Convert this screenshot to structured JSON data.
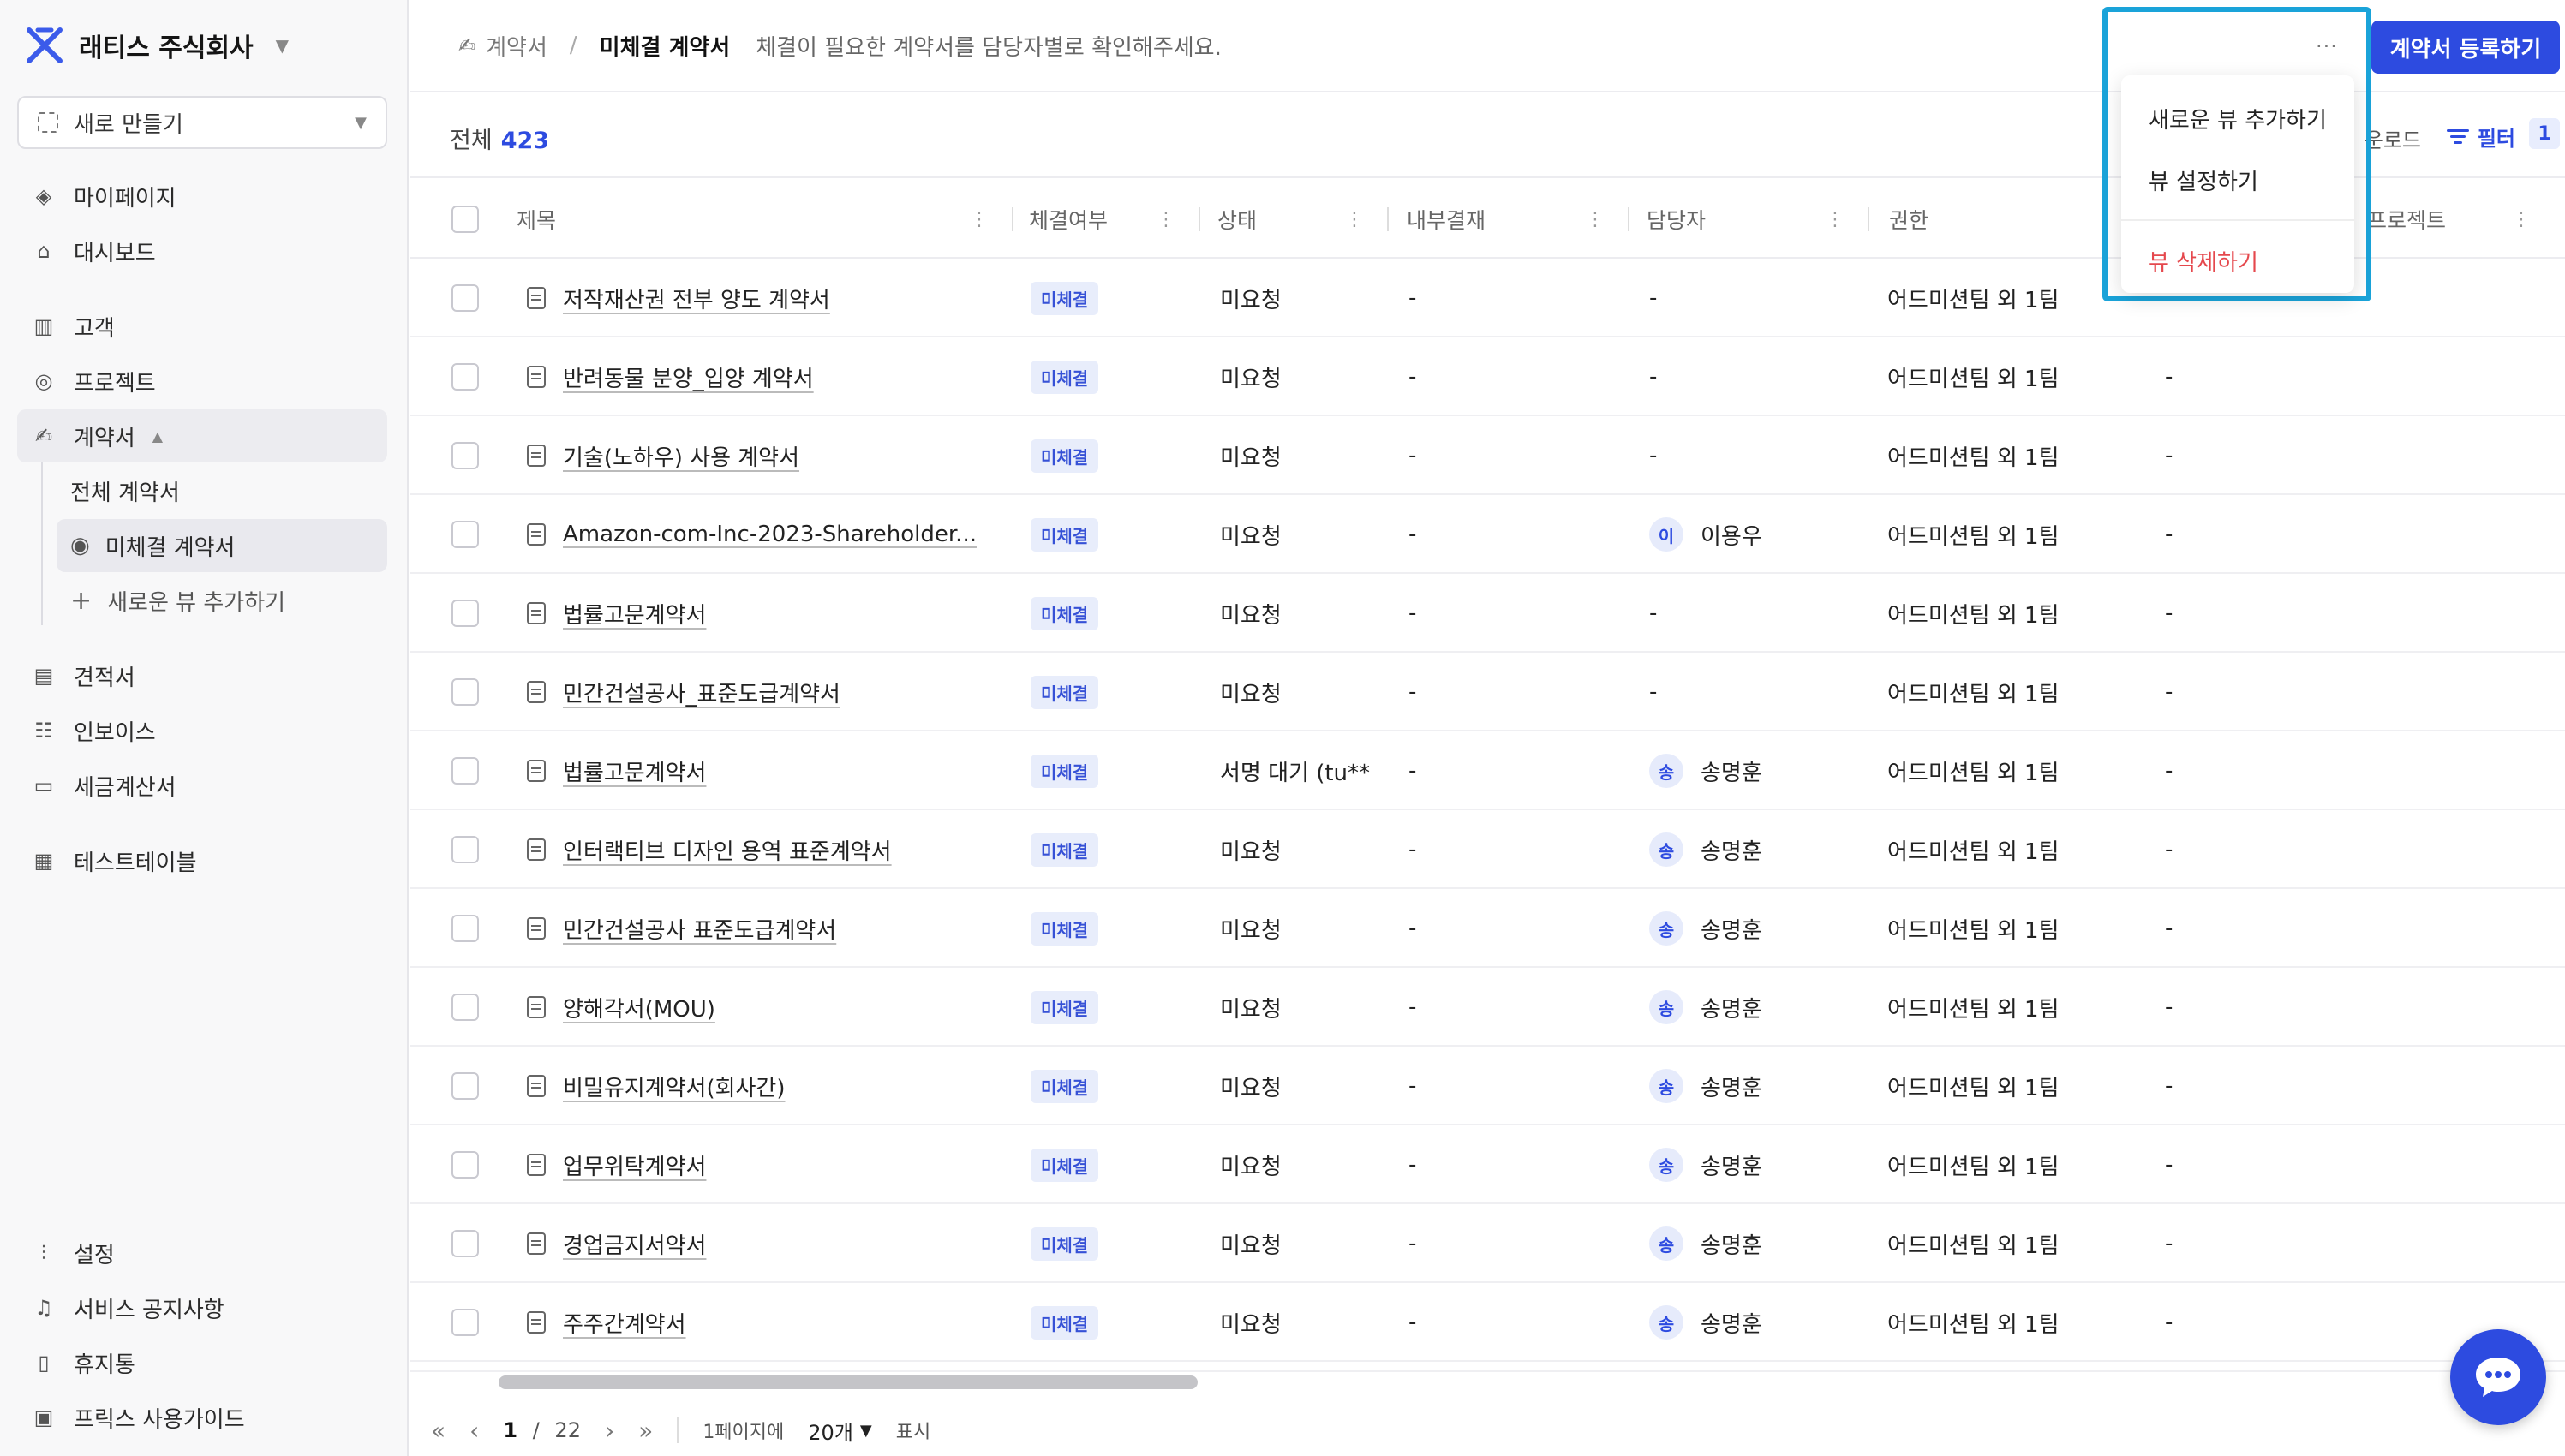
{
  "sidebar": {
    "company": "래티스 주식회사",
    "new_button": "새로 만들기",
    "items": [
      {
        "label": "마이페이지",
        "icon": "diamond-icon"
      },
      {
        "label": "대시보드",
        "icon": "home-icon"
      },
      {
        "label": "고객",
        "icon": "building-icon"
      },
      {
        "label": "프로젝트",
        "icon": "target-icon"
      },
      {
        "label": "계약서",
        "icon": "signature-icon"
      },
      {
        "label": "견적서",
        "icon": "document-icon"
      },
      {
        "label": "인보이스",
        "icon": "invoice-icon"
      },
      {
        "label": "세금계산서",
        "icon": "receipt-icon"
      },
      {
        "label": "테스트테이블",
        "icon": "table-icon"
      }
    ],
    "sub_items": [
      {
        "label": "전체 계약서"
      },
      {
        "label": "미체결 계약서"
      },
      {
        "label": "새로운 뷰 추가하기"
      }
    ],
    "bottom_items": [
      {
        "label": "설정",
        "icon": "sliders-icon"
      },
      {
        "label": "서비스 공지사항",
        "icon": "bell-icon"
      },
      {
        "label": "휴지통",
        "icon": "trash-icon"
      },
      {
        "label": "프릭스 사용가이드",
        "icon": "book-icon"
      }
    ]
  },
  "header": {
    "breadcrumb_parent": "계약서",
    "breadcrumb_current": "미체결 계약서",
    "description": "체결이 필요한 계약서를 담당자별로 확인해주세요.",
    "primary_button": "계약서 등록하기",
    "more_label": "···"
  },
  "toolbar": {
    "total_label": "전체",
    "total_count": "423",
    "download_label": "운로드",
    "filter_label": "필터",
    "filter_count": "1"
  },
  "table": {
    "columns": [
      "제목",
      "체결여부",
      "상태",
      "내부결재",
      "담당자",
      "권한",
      "프로젝트"
    ],
    "rows": [
      {
        "title": "저작재산권 전부 양도 계약서",
        "signed": "미체결",
        "status": "미요청",
        "approval": "-",
        "avatar": "",
        "manager": "-",
        "permission": "어드미션팀 외 1팀",
        "project": "-"
      },
      {
        "title": "반려동물 분양_입양 계약서",
        "signed": "미체결",
        "status": "미요청",
        "approval": "-",
        "avatar": "",
        "manager": "-",
        "permission": "어드미션팀 외 1팀",
        "project": "-"
      },
      {
        "title": "기술(노하우) 사용 계약서",
        "signed": "미체결",
        "status": "미요청",
        "approval": "-",
        "avatar": "",
        "manager": "-",
        "permission": "어드미션팀 외 1팀",
        "project": "-"
      },
      {
        "title": "Amazon-com-Inc-2023-Shareholder...",
        "signed": "미체결",
        "status": "미요청",
        "approval": "-",
        "avatar": "이",
        "manager": "이용우",
        "permission": "어드미션팀 외 1팀",
        "project": "-"
      },
      {
        "title": "법률고문계약서",
        "signed": "미체결",
        "status": "미요청",
        "approval": "-",
        "avatar": "",
        "manager": "-",
        "permission": "어드미션팀 외 1팀",
        "project": "-"
      },
      {
        "title": "민간건설공사_표준도급계약서",
        "signed": "미체결",
        "status": "미요청",
        "approval": "-",
        "avatar": "",
        "manager": "-",
        "permission": "어드미션팀 외 1팀",
        "project": "-"
      },
      {
        "title": "법률고문계약서",
        "signed": "미체결",
        "status": "서명 대기 (tu**",
        "approval": "-",
        "avatar": "송",
        "manager": "송명훈",
        "permission": "어드미션팀 외 1팀",
        "project": "-"
      },
      {
        "title": "인터랙티브 디자인 용역 표준계약서",
        "signed": "미체결",
        "status": "미요청",
        "approval": "-",
        "avatar": "송",
        "manager": "송명훈",
        "permission": "어드미션팀 외 1팀",
        "project": "-"
      },
      {
        "title": "민간건설공사 표준도급계약서",
        "signed": "미체결",
        "status": "미요청",
        "approval": "-",
        "avatar": "송",
        "manager": "송명훈",
        "permission": "어드미션팀 외 1팀",
        "project": "-"
      },
      {
        "title": "양해각서(MOU)",
        "signed": "미체결",
        "status": "미요청",
        "approval": "-",
        "avatar": "송",
        "manager": "송명훈",
        "permission": "어드미션팀 외 1팀",
        "project": "-"
      },
      {
        "title": "비밀유지계약서(회사간)",
        "signed": "미체결",
        "status": "미요청",
        "approval": "-",
        "avatar": "송",
        "manager": "송명훈",
        "permission": "어드미션팀 외 1팀",
        "project": "-"
      },
      {
        "title": "업무위탁계약서",
        "signed": "미체결",
        "status": "미요청",
        "approval": "-",
        "avatar": "송",
        "manager": "송명훈",
        "permission": "어드미션팀 외 1팀",
        "project": "-"
      },
      {
        "title": "경업금지서약서",
        "signed": "미체결",
        "status": "미요청",
        "approval": "-",
        "avatar": "송",
        "manager": "송명훈",
        "permission": "어드미션팀 외 1팀",
        "project": "-"
      },
      {
        "title": "주주간계약서",
        "signed": "미체결",
        "status": "미요청",
        "approval": "-",
        "avatar": "송",
        "manager": "송명훈",
        "permission": "어드미션팀 외 1팀",
        "project": "-"
      }
    ]
  },
  "pagination": {
    "current": "1",
    "separator": "/",
    "total": "22",
    "per_page_label": "1페이지에",
    "per_page_value": "20개",
    "display_label": "표시"
  },
  "menu": {
    "items": [
      {
        "label": "새로운 뷰 추가하기"
      },
      {
        "label": "뷰 설정하기"
      },
      {
        "label": "뷰 삭제하기"
      }
    ]
  },
  "colors": {
    "accent": "#2d4be0",
    "highlight": "#1aa3d9",
    "danger": "#e5484d"
  }
}
